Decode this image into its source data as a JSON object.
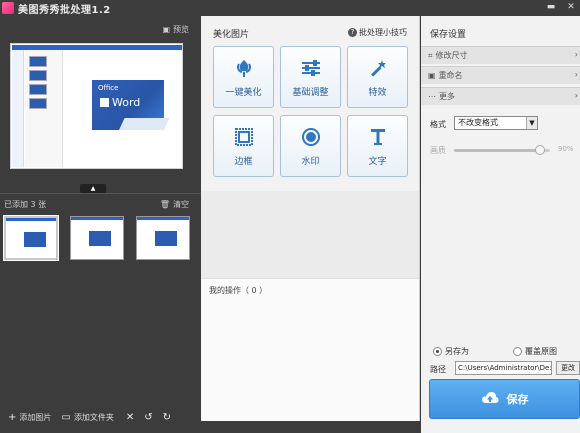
{
  "window": {
    "title": "美图秀秀批处理1.2"
  },
  "left": {
    "preview_label": "预览",
    "added_count": "已添加 3 张",
    "clear_label": "清空",
    "add_image_label": "添加图片",
    "add_folder_label": "添加文件夹",
    "preview_card": {
      "office": "Office",
      "word": "Word"
    }
  },
  "middle": {
    "title": "美化图片",
    "tips_label": "批处理小技巧",
    "tools": [
      {
        "label": "一键美化",
        "icon": "tulip-icon"
      },
      {
        "label": "基础调整",
        "icon": "sliders-icon"
      },
      {
        "label": "特效",
        "icon": "magic-wand-icon"
      },
      {
        "label": "边框",
        "icon": "frame-icon"
      },
      {
        "label": "水印",
        "icon": "watermark-icon"
      },
      {
        "label": "文字",
        "icon": "text-icon"
      }
    ],
    "ops_label": "我的操作（ 0 ）"
  },
  "right": {
    "title": "保存设置",
    "sections": [
      {
        "label": "修改尺寸",
        "icon": "crop-icon"
      },
      {
        "label": "重命名",
        "icon": "rename-icon"
      },
      {
        "label": "更多",
        "icon": "more-icon"
      }
    ],
    "format_label": "格式",
    "format_value": "不改变格式",
    "quality_label": "画质",
    "quality_value": "90%",
    "quality_level": 0.9,
    "save_as_label": "另存为",
    "overwrite_label": "覆盖原图",
    "path_label": "路径",
    "path_value": "C:\\Users\\Administrator\\De:",
    "path_button": "更改",
    "save_button": "保存"
  },
  "colors": {
    "accent": "#3c92df",
    "tool_icon": "#2f78c0"
  }
}
